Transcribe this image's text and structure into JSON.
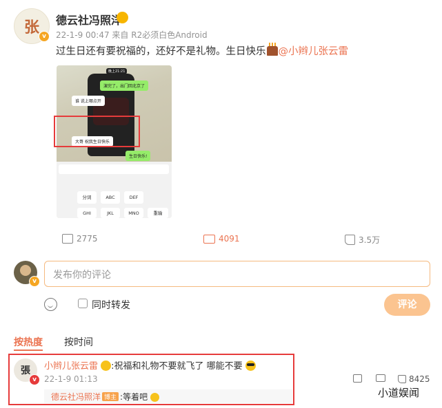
{
  "post": {
    "author": "德云社冯照洋",
    "avatar_glyph": "张",
    "meta": "22-1-9 00:47  来自 R2必须白色Android",
    "text_before": "过生日还有要祝福的，还好不是礼物。生日快乐",
    "mention": "@小辫儿张云雷",
    "image": {
      "status_time": "晚上21:21",
      "bubble1": "演完了，出门回北京了",
      "bubble2": "谁 说上哪点开",
      "bubble3": "大哥 祝我生日快乐",
      "bubble4": "生日快乐!",
      "keys_row1": [
        "分词",
        "ABC",
        "DEF"
      ],
      "keys_row2": [
        "GHI",
        "JKL",
        "MNO",
        "重输"
      ]
    },
    "stats": {
      "reposts": "2775",
      "comments": "4091",
      "likes": "3.5万"
    }
  },
  "comment_box": {
    "placeholder": "发布你的评论",
    "repost_label": "同时转发",
    "submit_label": "评论"
  },
  "tabs": [
    {
      "label": "按热度",
      "active": true
    },
    {
      "label": "按时间",
      "active": false
    }
  ],
  "comments": [
    {
      "avatar_glyph": "張",
      "user": "小辫儿张云雷",
      "text": ":祝福和礼物不要就飞了 哪能不要",
      "time": "22-1-9 01:13",
      "likes": "8425",
      "reply": {
        "user": "德云社冯照洋",
        "tag": "博主",
        "text": ":等着吧"
      }
    }
  ],
  "watermark": "小道娱闻",
  "colors": {
    "accent": "#eb7350",
    "highlight_border": "#e63b3b",
    "verified": "#f5a623"
  }
}
